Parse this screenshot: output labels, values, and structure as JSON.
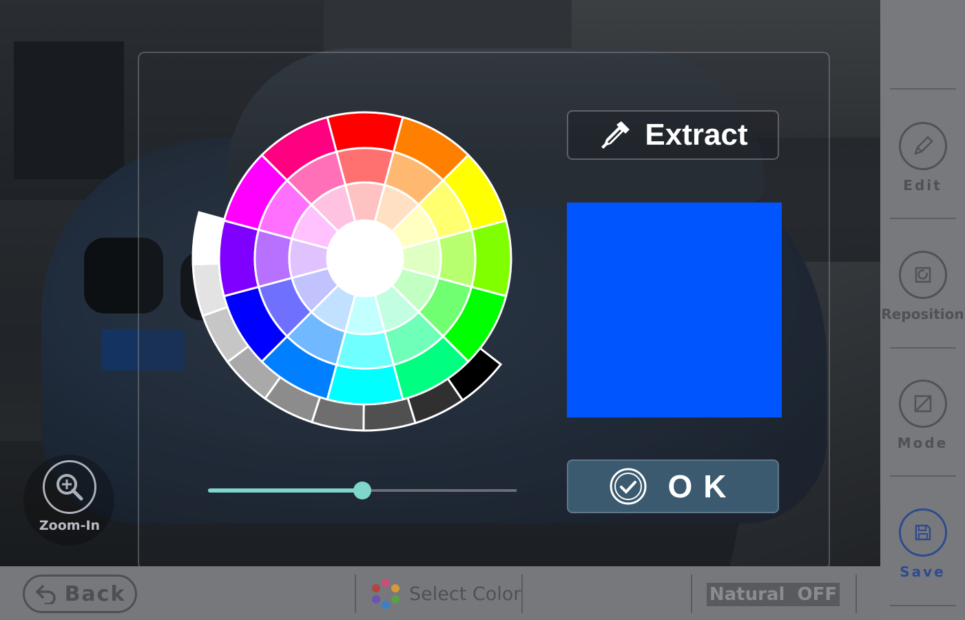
{
  "dialog": {
    "extract_label": "Extract",
    "ok_label": "OK",
    "selected_color": "#0055ff",
    "slider_value": 0.5
  },
  "zoom": {
    "label": "Zoom-In"
  },
  "right_panel": {
    "items": [
      {
        "label": "Edit",
        "icon": "pencil-icon"
      },
      {
        "label": "Reposition",
        "icon": "reposition-icon"
      },
      {
        "label": "Mode",
        "icon": "mode-icon"
      },
      {
        "label": "Save",
        "icon": "save-icon"
      }
    ]
  },
  "bottom_bar": {
    "back_label": "Back",
    "select_color_label": "Select Color",
    "natural_label": "Natural  OFF"
  },
  "colors": {
    "accent": "#7fd6cc",
    "ok_button": "#3c5a6f",
    "save_accent": "#2f4b8e"
  }
}
